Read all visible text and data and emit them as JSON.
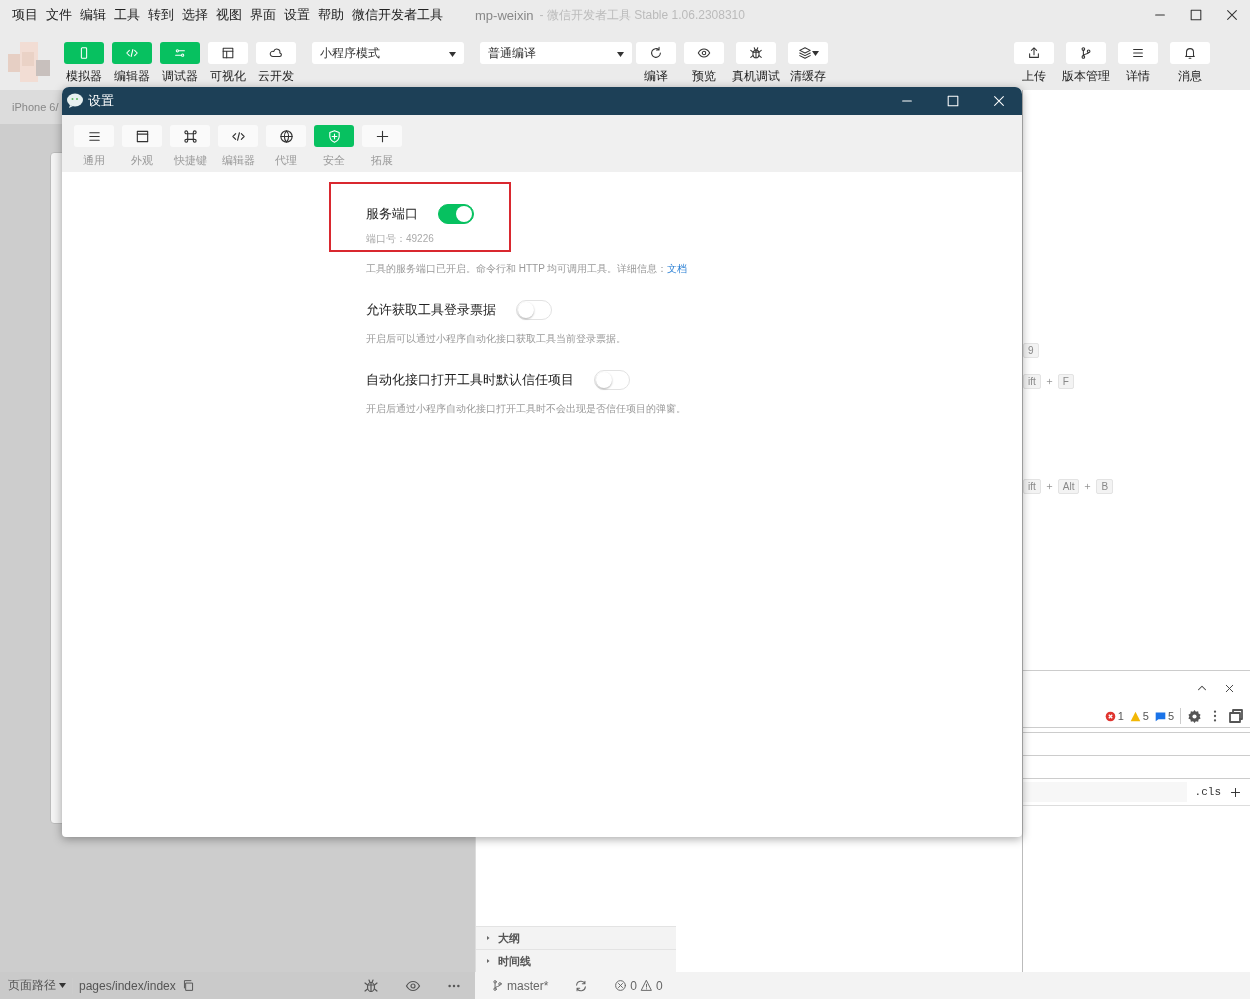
{
  "menu": [
    "项目",
    "文件",
    "编辑",
    "工具",
    "转到",
    "选择",
    "视图",
    "界面",
    "设置",
    "帮助",
    "微信开发者工具"
  ],
  "window": {
    "title": "mp-weixin",
    "subtitle": "- 微信开发者工具 Stable 1.06.2308310"
  },
  "toolbar": {
    "tools": [
      {
        "label": "模拟器",
        "on": true
      },
      {
        "label": "编辑器",
        "on": true
      },
      {
        "label": "调试器",
        "on": true
      },
      {
        "label": "可视化",
        "on": false
      },
      {
        "label": "云开发",
        "on": false
      }
    ],
    "mode_select": "小程序模式",
    "compile_select": "普通编译",
    "actions": [
      {
        "label": "编译"
      },
      {
        "label": "预览"
      },
      {
        "label": "真机调试"
      },
      {
        "label": "清缓存"
      }
    ],
    "right_actions": [
      {
        "label": "上传"
      },
      {
        "label": "版本管理"
      },
      {
        "label": "详情"
      },
      {
        "label": "消息"
      }
    ]
  },
  "simulator": {
    "device": "iPhone 6/"
  },
  "side_sections": [
    {
      "label": "大纲",
      "expanded": false
    },
    {
      "label": "时间线",
      "expanded": false
    }
  ],
  "shortcut_hints": [
    [
      "9"
    ],
    [
      "ift",
      "F"
    ],
    [
      "ift",
      "Alt",
      "B"
    ]
  ],
  "devtools": {
    "errors": "1",
    "warnings": "5",
    "infos": "5",
    "filter_button": ".cls"
  },
  "status_bar": {
    "page_path_label": "页面路径",
    "page_path": "pages/index/index",
    "branch": "master*",
    "errors": "0",
    "warnings": "0"
  },
  "settings_dialog": {
    "title": "设置",
    "tabs": [
      {
        "label": "通用",
        "selected": false
      },
      {
        "label": "外观",
        "selected": false
      },
      {
        "label": "快捷键",
        "selected": false
      },
      {
        "label": "编辑器",
        "selected": false
      },
      {
        "label": "代理",
        "selected": false
      },
      {
        "label": "安全",
        "selected": true
      },
      {
        "label": "拓展",
        "selected": false
      }
    ],
    "options": [
      {
        "label": "服务端口",
        "on": true,
        "highlighted": true,
        "port": "端口号：49226",
        "description": "工具的服务端口已开启。命令行和 HTTP 均可调用工具。详细信息：",
        "link": "文档"
      },
      {
        "label": "允许获取工具登录票据",
        "on": false,
        "highlighted": false,
        "description": "开启后可以通过小程序自动化接口获取工具当前登录票据。"
      },
      {
        "label": "自动化接口打开工具时默认信任项目",
        "on": false,
        "highlighted": false,
        "description": "开启后通过小程序自动化接口打开工具时不会出现是否信任项目的弹窗。"
      }
    ]
  }
}
